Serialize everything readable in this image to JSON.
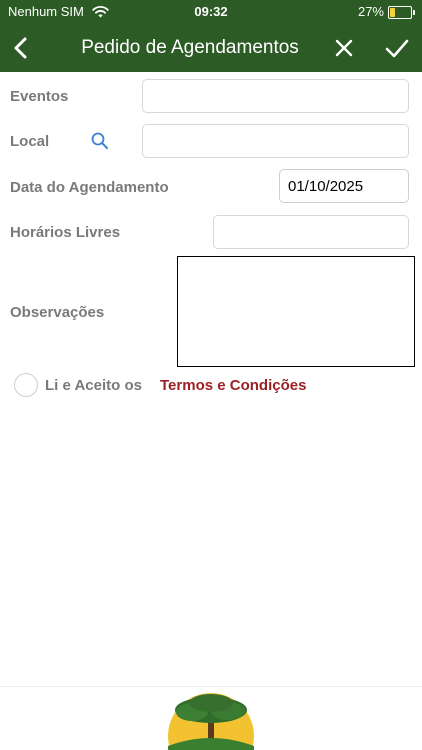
{
  "status_bar": {
    "carrier": "Nenhum SIM",
    "time": "09:32",
    "battery_percent": "27%",
    "battery_level": 0.27
  },
  "nav": {
    "title": "Pedido de Agendamentos",
    "back_icon": "chevron-left-icon",
    "close_icon": "close-icon",
    "confirm_icon": "checkmark-icon"
  },
  "form": {
    "eventos_label": "Eventos",
    "eventos_value": "",
    "local_label": "Local",
    "local_value": "",
    "data_label": "Data do Agendamento",
    "data_value": "01/10/2025",
    "horarios_label": "Horários Livres",
    "horarios_value": "",
    "observacoes_label": "Observações",
    "observacoes_value": ""
  },
  "terms": {
    "prefix": "Li e Aceito os",
    "link": "Termos e Condições"
  },
  "colors": {
    "header_green": "#2c5b25",
    "label_gray": "#7a7a7a",
    "link_red": "#9b2224"
  }
}
